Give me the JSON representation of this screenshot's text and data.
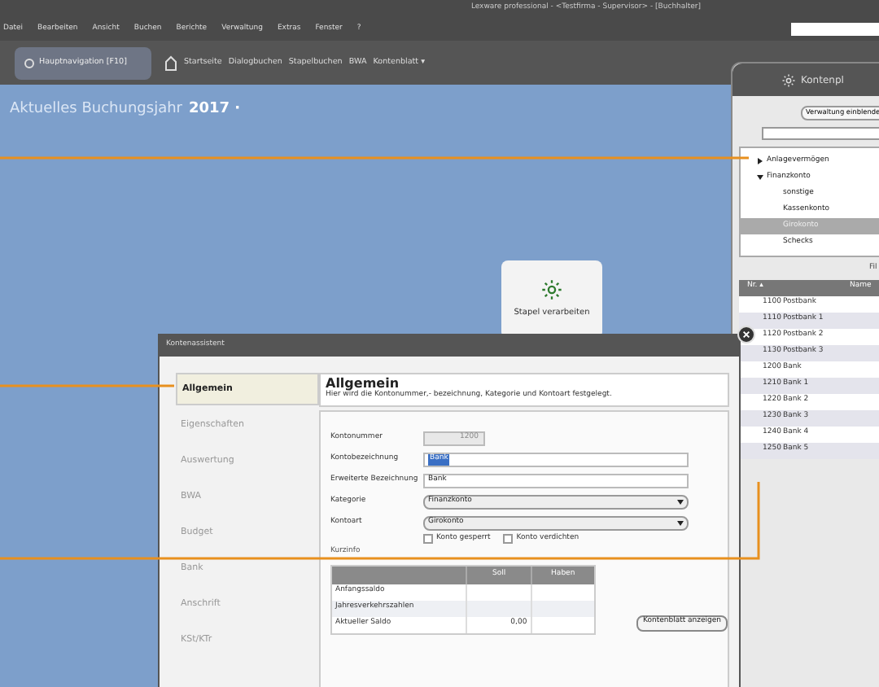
{
  "window": {
    "title": "Lexware professional - <Testfirma - Supervisor> - [Buchhalter]"
  },
  "menu": [
    "Datei",
    "Bearbeiten",
    "Ansicht",
    "Buchen",
    "Berichte",
    "Verwaltung",
    "Extras",
    "Fenster",
    "?"
  ],
  "nav": {
    "main_button": "Hauptnavigation [F10]",
    "links": [
      "Startseite",
      "Dialogbuchen",
      "Stapelbuchen",
      "BWA",
      "Kontenblatt ▾"
    ]
  },
  "year": {
    "label": "Aktuelles Buchungsjahr",
    "value": "2017 ·"
  },
  "tile": {
    "label": "Stapel verarbeiten"
  },
  "account_panel": {
    "title": "Kontenpl",
    "toggle_button": "Verwaltung einblende",
    "tree": [
      {
        "label": "Anlagevermögen",
        "expanded": false,
        "selected": false
      },
      {
        "label": "Finanzkonto",
        "expanded": true,
        "selected": false,
        "children": [
          {
            "label": "sonstige",
            "selected": false
          },
          {
            "label": "Kassenkonto",
            "selected": false
          },
          {
            "label": "Girokonto",
            "selected": true
          },
          {
            "label": "Schecks",
            "selected": false
          }
        ]
      }
    ],
    "filter_label": "Fil",
    "columns": [
      "Nr. ▴",
      "Name"
    ],
    "rows": [
      [
        "1100",
        "Postbank"
      ],
      [
        "1110",
        "Postbank 1"
      ],
      [
        "1120",
        "Postbank 2"
      ],
      [
        "1130",
        "Postbank 3"
      ],
      [
        "1200",
        "Bank"
      ],
      [
        "1210",
        "Bank 1"
      ],
      [
        "1220",
        "Bank 2"
      ],
      [
        "1230",
        "Bank 3"
      ],
      [
        "1240",
        "Bank 4"
      ],
      [
        "1250",
        "Bank 5"
      ]
    ]
  },
  "dialog": {
    "title": "Kontenassistent",
    "steps": [
      {
        "label": "Allgemein",
        "selected": true
      },
      {
        "label": "Eigenschaften",
        "selected": false
      },
      {
        "label": "Auswertung",
        "selected": false
      },
      {
        "label": "BWA",
        "selected": false
      },
      {
        "label": "Budget",
        "selected": false
      },
      {
        "label": "Bank",
        "selected": false
      },
      {
        "label": "Anschrift",
        "selected": false
      },
      {
        "label": "KSt/KTr",
        "selected": false
      }
    ],
    "heading": "Allgemein",
    "description": "Hier wird die Kontonummer,- bezeichnung, Kategorie und Kontoart festgelegt.",
    "fields": [
      {
        "kind": "number",
        "label": "Kontonummer",
        "value": "1200",
        "disabled": true
      },
      {
        "kind": "text",
        "label": "Kontobezeichnung",
        "value": "Bank",
        "highlighted": true
      },
      {
        "kind": "text",
        "label": "Erweiterte Bezeichnung",
        "value": "Bank",
        "highlighted": false
      },
      {
        "kind": "select",
        "label": "Kategorie",
        "value": "Finanzkonto"
      },
      {
        "kind": "select",
        "label": "Kontoart",
        "value": "Girokonto"
      }
    ],
    "checkboxes": [
      {
        "label": "Konto gesperrt",
        "checked": false
      },
      {
        "label": "Konto verdichten",
        "checked": false
      }
    ],
    "info_label": "Kurzinfo",
    "info_columns": [
      "Soll",
      "Haben"
    ],
    "info_rows": [
      [
        "Anfangssaldo",
        "",
        ""
      ],
      [
        "Jahresverkehrszahlen",
        "",
        ""
      ],
      [
        "Aktueller Saldo",
        "0,00",
        ""
      ]
    ],
    "show_button": "Kontenblatt anzeigen"
  }
}
